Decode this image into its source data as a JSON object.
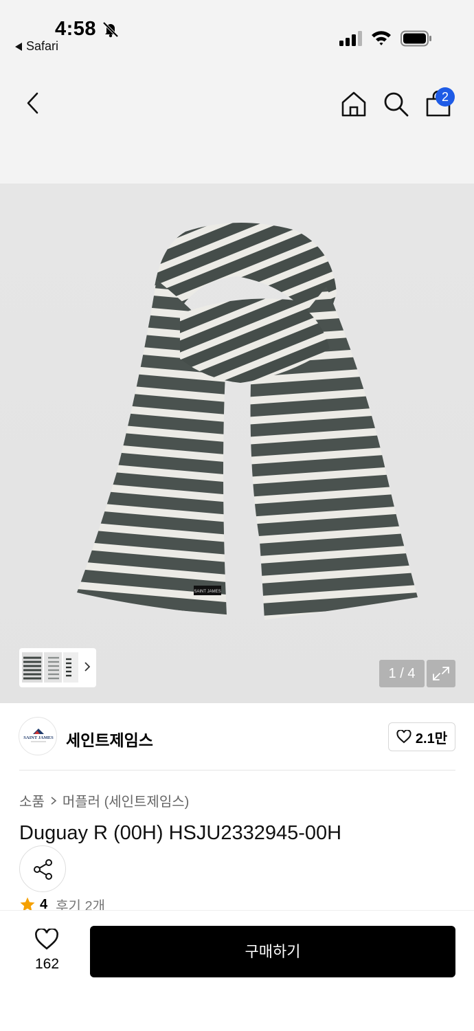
{
  "status_bar": {
    "time": "4:58",
    "back_app_label": "Safari",
    "icons": [
      "bell-slash-icon",
      "cellular-signal-icon",
      "wifi-icon",
      "battery-icon"
    ]
  },
  "nav": {
    "icons": [
      "back-chevron-icon",
      "home-icon",
      "search-icon",
      "shopping-bag-icon"
    ],
    "cart_count": "2",
    "badge_color": "#1e5be6"
  },
  "gallery": {
    "counter": "1 / 4",
    "label_text": "SAINT JAMES",
    "scarf_colors": {
      "dark": "#4a524f",
      "light": "#ecebe6"
    }
  },
  "brand": {
    "name": "세인트제임스",
    "logo_text": "SAINT JAMES",
    "likes": "2.1만"
  },
  "product": {
    "breadcrumb": [
      "소품",
      "머플러 (세인트제임스)"
    ],
    "title": "Duguay R (00H) HSJU2332945-00H",
    "rating": "4",
    "reviews": "후기 2개",
    "star_color": "#f5a000"
  },
  "bottom": {
    "wish_count": "162",
    "buy_label": "구매하기"
  }
}
